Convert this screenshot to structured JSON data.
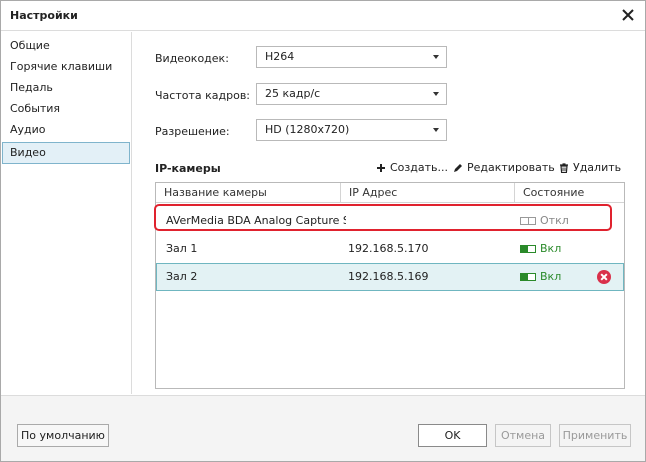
{
  "window": {
    "title": "Настройки"
  },
  "sidebar": {
    "items": [
      {
        "label": "Общие"
      },
      {
        "label": "Горячие клавиши"
      },
      {
        "label": "Педаль"
      },
      {
        "label": "События"
      },
      {
        "label": "Аудио"
      },
      {
        "label": "Видео"
      }
    ],
    "active": "Видео"
  },
  "video": {
    "codec_label": "Видеокодек:",
    "codec_value": "H264",
    "framerate_label": "Частота кадров:",
    "framerate_value": "25 кадр/с",
    "resolution_label": "Разрешение:",
    "resolution_value": "HD (1280x720)"
  },
  "ip_cameras": {
    "title": "IP-камеры",
    "toolbar": {
      "create_label": "Создать...",
      "edit_label": "Редактировать",
      "delete_label": "Удалить"
    },
    "columns": {
      "name": "Название камеры",
      "ip": "IP Адрес",
      "status": "Состояние"
    },
    "rows": [
      {
        "name": "AVerMedia BDA Analog Capture S",
        "ip": "",
        "status": "Откл",
        "on": false
      },
      {
        "name": "Зал 1",
        "ip": "192.168.5.170",
        "status": "Вкл",
        "on": true
      },
      {
        "name": "Зал 2",
        "ip": "192.168.5.169",
        "status": "Вкл",
        "on": true
      }
    ]
  },
  "footer": {
    "defaults_label": "По умолчанию",
    "ok_label": "OK",
    "cancel_label": "Отмена",
    "apply_label": "Применить"
  },
  "colors": {
    "accent": "#6fb6c0",
    "status_on": "#2a8a2a",
    "delete": "#d9304a",
    "highlight": "#e0222e"
  }
}
